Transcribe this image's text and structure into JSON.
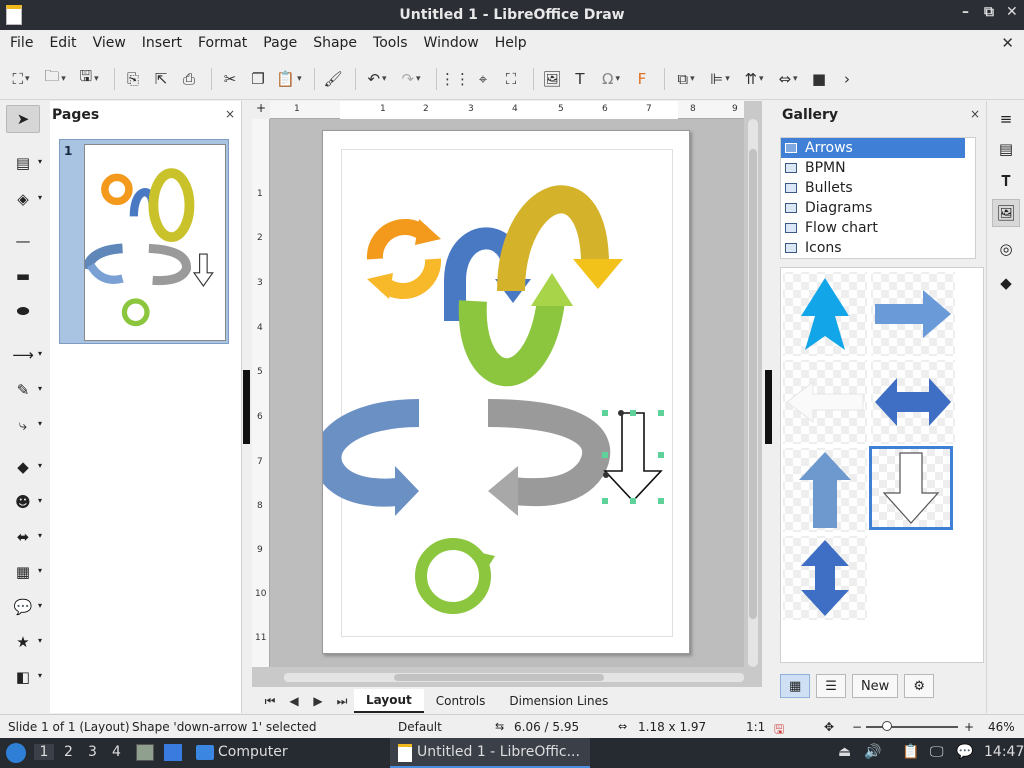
{
  "window": {
    "title": "Untitled 1 - LibreOffice Draw",
    "minimize": "–",
    "restore": "⧉",
    "close": "✕"
  },
  "menu": [
    "File",
    "Edit",
    "View",
    "Insert",
    "Format",
    "Page",
    "Shape",
    "Tools",
    "Window",
    "Help"
  ],
  "menu_close": "✕",
  "pages_panel": {
    "title": "Pages",
    "close": "×",
    "thumb_number": "1"
  },
  "ruler": {
    "h_numbers": [
      "1",
      "1",
      "2",
      "3",
      "4",
      "5",
      "6",
      "7",
      "8",
      "9"
    ],
    "v_numbers": [
      "1",
      "2",
      "3",
      "4",
      "5",
      "6",
      "7",
      "8",
      "9",
      "10",
      "11"
    ]
  },
  "tabs": [
    "Layout",
    "Controls",
    "Dimension Lines"
  ],
  "gallery": {
    "title": "Gallery",
    "close": "×",
    "themes": [
      "Arrows",
      "BPMN",
      "Bullets",
      "Diagrams",
      "Flow chart",
      "Icons"
    ],
    "selected_theme": "Arrows",
    "new_button": "New"
  },
  "status": {
    "slide": "Slide 1 of 1 (Layout)",
    "selection": "Shape 'down-arrow 1' selected",
    "layout": "Default",
    "position": "6.06 / 5.95",
    "size": "1.18 x 1.97",
    "scale": "1:1",
    "zoom": "46%",
    "zoom_level": 46
  },
  "taskbar": {
    "workspaces": [
      "1",
      "2",
      "3",
      "4"
    ],
    "computer": "Computer",
    "active_window": "Untitled 1 - LibreOffic...",
    "time": "14:47"
  },
  "colors": {
    "selection_blue": "#3f7fd6",
    "orange": "#f39a1d",
    "yellow": "#f2c21a",
    "green": "#8cc63f",
    "blue": "#4a79c4",
    "gray": "#9a9a9a"
  }
}
